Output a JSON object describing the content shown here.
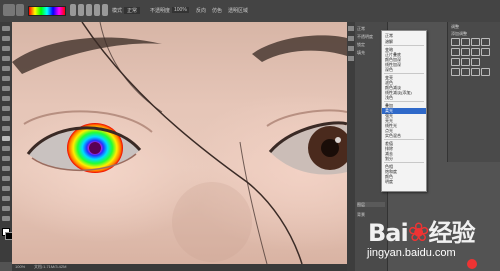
{
  "app": {
    "name": "Photoshop"
  },
  "options_bar": {
    "mode_label": "模式",
    "mode_value": "正常",
    "opacity_label": "不透明度",
    "opacity_value": "100%",
    "reverse_label": "反向",
    "dither_label": "仿色",
    "transparency_label": "透明区域"
  },
  "status_bar": {
    "zoom": "100%",
    "doc": "文档:1.71M/3.42M"
  },
  "layers_panel": {
    "rows": [
      "正常",
      "不透明度",
      "锁定",
      "填充",
      "图层",
      "背景"
    ]
  },
  "blend_menu": {
    "items": [
      {
        "label": "正常",
        "group": 1
      },
      {
        "label": "溶解",
        "group": 1
      },
      {
        "label": "变暗",
        "group": 2
      },
      {
        "label": "正片叠底",
        "group": 2
      },
      {
        "label": "颜色加深",
        "group": 2
      },
      {
        "label": "线性加深",
        "group": 2
      },
      {
        "label": "深色",
        "group": 2
      },
      {
        "label": "变亮",
        "group": 3
      },
      {
        "label": "滤色",
        "group": 3
      },
      {
        "label": "颜色减淡",
        "group": 3
      },
      {
        "label": "线性减淡(添加)",
        "group": 3
      },
      {
        "label": "浅色",
        "group": 3
      },
      {
        "label": "叠加",
        "group": 4
      },
      {
        "label": "柔光",
        "group": 4,
        "highlighted": true
      },
      {
        "label": "强光",
        "group": 4
      },
      {
        "label": "亮光",
        "group": 4
      },
      {
        "label": "线性光",
        "group": 4
      },
      {
        "label": "点光",
        "group": 4
      },
      {
        "label": "实色混合",
        "group": 4
      },
      {
        "label": "差值",
        "group": 5
      },
      {
        "label": "排除",
        "group": 5
      },
      {
        "label": "减去",
        "group": 5
      },
      {
        "label": "划分",
        "group": 5
      },
      {
        "label": "色相",
        "group": 6
      },
      {
        "label": "饱和度",
        "group": 6
      },
      {
        "label": "颜色",
        "group": 6
      },
      {
        "label": "明度",
        "group": 6
      }
    ]
  },
  "adjustments_panel": {
    "title": "调整",
    "subtitle": "添加调整"
  },
  "watermark": {
    "brand": "Bai",
    "brand_suffix": "经验",
    "url": "jingyan.baidu.com"
  },
  "colors": {
    "accent": "#2f69c9",
    "panel_bg": "#4a4a4a",
    "chrome_bg": "#535353",
    "watermark_red": "#e33333"
  }
}
